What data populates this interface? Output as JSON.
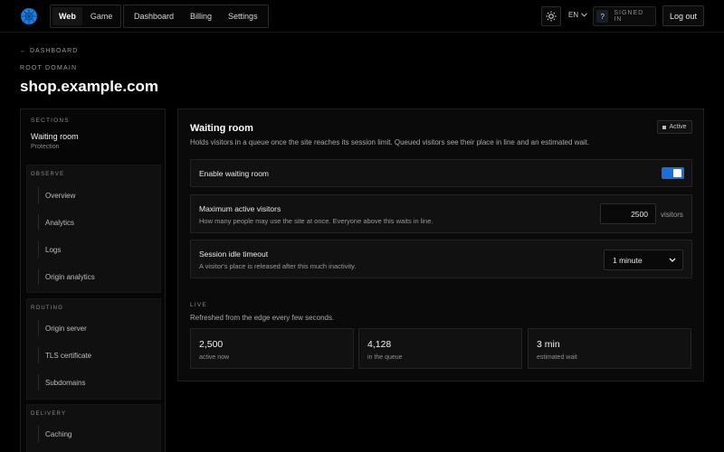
{
  "topbar": {
    "segments": [
      {
        "label": "Web",
        "active": true
      },
      {
        "label": "Game",
        "active": false
      }
    ],
    "nav": [
      "Dashboard",
      "Billing",
      "Settings"
    ],
    "theme_icon": "sun-icon",
    "language": "EN",
    "help_icon": "?",
    "signed_in": "SIGNED IN",
    "logout": "Log out"
  },
  "header": {
    "back": "← DASHBOARD",
    "root_label": "ROOT DOMAIN",
    "domain": "shop.example.com"
  },
  "sidebar": {
    "sections_label": "SECTIONS",
    "current": "Waiting room",
    "current_sub": "Protection",
    "groups": [
      {
        "title": "OBSERVE",
        "items": [
          "Overview",
          "Analytics",
          "Logs",
          "Origin analytics"
        ]
      },
      {
        "title": "ROUTING",
        "items": [
          "Origin server",
          "TLS certificate",
          "Subdomains"
        ]
      },
      {
        "title": "DELIVERY",
        "items": [
          "Caching"
        ]
      }
    ]
  },
  "main": {
    "title": "Waiting room",
    "description": "Holds visitors in a queue once the site reaches its session limit. Queued visitors see their place in line and an estimated wait.",
    "status": "Active",
    "enable": {
      "label": "Enable waiting room",
      "enabled": true
    },
    "max_visitors": {
      "label": "Maximum active visitors",
      "sub": "How many people may use the site at once. Everyone above this waits in line.",
      "value": "2500",
      "unit": "visitors"
    },
    "idle_timeout": {
      "label": "Session idle timeout",
      "sub": "A visitor's place is released after this much inactivity.",
      "value": "1 minute"
    },
    "live": {
      "label": "LIVE",
      "sub": "Refreshed from the edge every few seconds.",
      "stats": [
        {
          "value": "2,500",
          "label": "active now"
        },
        {
          "value": "4,128",
          "label": "in the queue"
        },
        {
          "value": "3 min",
          "label": "estimated wait"
        }
      ]
    }
  },
  "colors": {
    "accent": "#1d6fd6",
    "background": "#000000",
    "panel": "#111111"
  }
}
